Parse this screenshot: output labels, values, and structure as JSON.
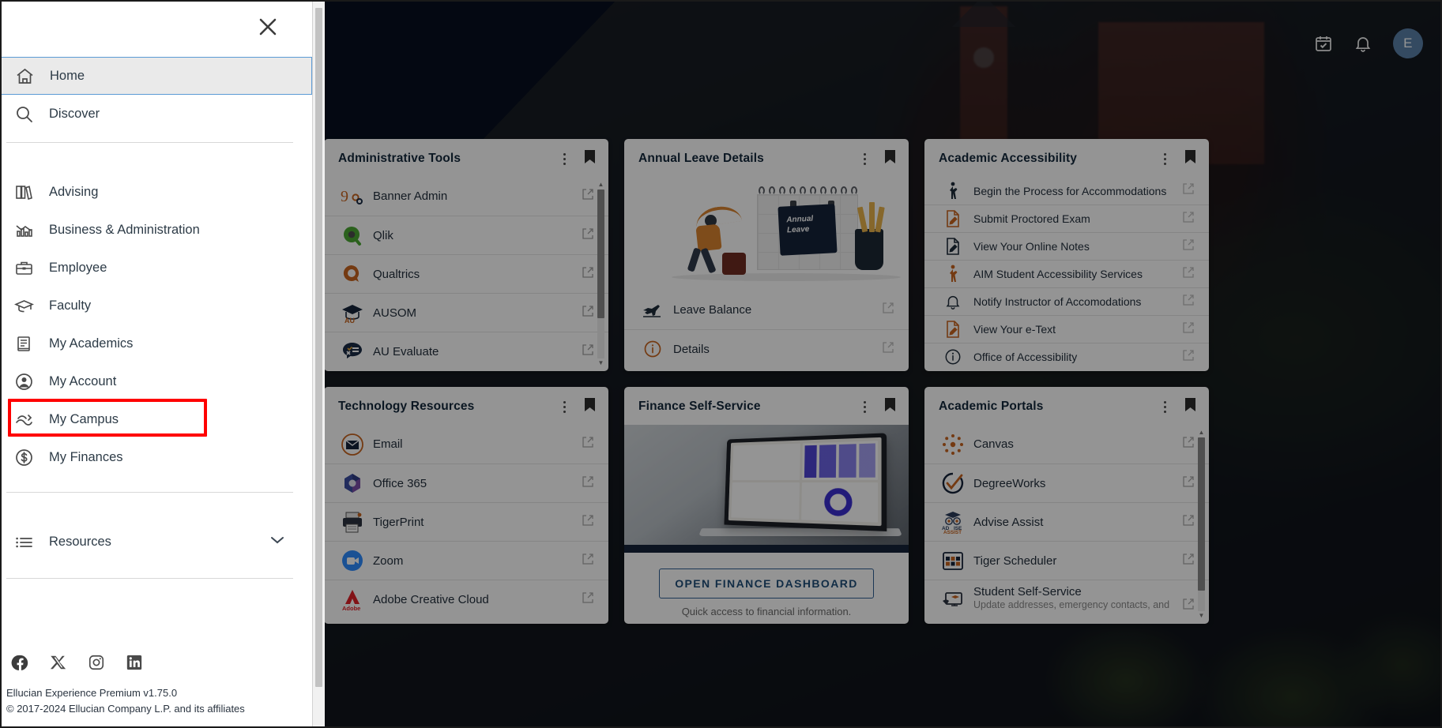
{
  "header": {
    "calendar_icon": "calendar-check-icon",
    "notifications_icon": "bell-icon",
    "avatar_initial": "E"
  },
  "sidebar": {
    "close_label": "close-icon",
    "primary_items": [
      {
        "label": "Home",
        "icon": "home-icon",
        "active": true
      },
      {
        "label": "Discover",
        "icon": "search-icon",
        "active": false
      }
    ],
    "section_items": [
      {
        "label": "Advising",
        "icon": "books-icon"
      },
      {
        "label": "Business & Administration",
        "icon": "chart-icon"
      },
      {
        "label": "Employee",
        "icon": "briefcase-icon"
      },
      {
        "label": "Faculty",
        "icon": "graduation-cap-icon"
      },
      {
        "label": "My Academics",
        "icon": "book-icon"
      },
      {
        "label": "My Account",
        "icon": "user-circle-icon"
      },
      {
        "label": "My Campus",
        "icon": "campus-icon",
        "highlighted": true
      },
      {
        "label": "My Finances",
        "icon": "dollar-circle-icon"
      }
    ],
    "resources": {
      "label": "Resources",
      "icon": "list-icon",
      "chevron": "chevron-down-icon"
    },
    "socials": [
      {
        "name": "facebook-icon"
      },
      {
        "name": "x-twitter-icon"
      },
      {
        "name": "instagram-icon"
      },
      {
        "name": "linkedin-icon"
      }
    ],
    "footer": {
      "version": "Ellucian Experience Premium v1.75.0",
      "copyright": "© 2017-2024 Ellucian Company L.P. and its affiliates"
    }
  },
  "cards": {
    "partial_left_row1": {
      "title": "",
      "kebab": "kebab-menu-icon",
      "bookmark": "bookmark-icon"
    },
    "partial_left_row2": {
      "title": "",
      "kebab": "kebab-menu-icon",
      "bookmark": "bookmark-icon"
    },
    "administrative_tools": {
      "title": "Administrative Tools",
      "items": [
        {
          "label": "Banner Admin",
          "icon": "banner9-icon"
        },
        {
          "label": "Qlik",
          "icon": "qlik-icon"
        },
        {
          "label": "Qualtrics",
          "icon": "qualtrics-icon"
        },
        {
          "label": "AUSOM",
          "icon": "ausom-icon"
        },
        {
          "label": "AU Evaluate",
          "icon": "au-evaluate-icon"
        }
      ]
    },
    "annual_leave": {
      "title": "Annual Leave Details",
      "illustration_text": "Annual\nLeave",
      "items": [
        {
          "label": "Leave Balance",
          "icon": "airplane-icon"
        },
        {
          "label": "Details",
          "icon": "info-circle-icon"
        }
      ]
    },
    "academic_accessibility": {
      "title": "Academic Accessibility",
      "items": [
        {
          "label": "Begin the Process for Accommodations",
          "icon": "walking-person-icon"
        },
        {
          "label": "Submit Proctored Exam",
          "icon": "document-edit-orange-icon"
        },
        {
          "label": "View Your Online Notes",
          "icon": "document-edit-navy-icon"
        },
        {
          "label": "AIM Student Accessibility Services",
          "icon": "walking-person-orange-icon"
        },
        {
          "label": "Notify Instructor of Accomodations",
          "icon": "bell-icon"
        },
        {
          "label": "View Your e-Text",
          "icon": "document-edit-orange-icon"
        },
        {
          "label": "Office of Accessibility",
          "icon": "info-circle-icon"
        }
      ]
    },
    "technology_resources": {
      "title": "Technology Resources",
      "items": [
        {
          "label": "Email",
          "icon": "envelope-icon"
        },
        {
          "label": "Office 365",
          "icon": "office365-icon"
        },
        {
          "label": "TigerPrint",
          "icon": "printer-icon"
        },
        {
          "label": "Zoom",
          "icon": "zoom-icon"
        },
        {
          "label": "Adobe Creative Cloud",
          "icon": "adobe-icon"
        }
      ]
    },
    "finance_self_service": {
      "title": "Finance Self-Service",
      "cta_label": "OPEN FINANCE DASHBOARD",
      "note": "Quick access to financial information."
    },
    "academic_portals": {
      "title": "Academic Portals",
      "items": [
        {
          "label": "Canvas",
          "icon": "canvas-icon",
          "sub": ""
        },
        {
          "label": "DegreeWorks",
          "icon": "degreeworks-icon",
          "sub": ""
        },
        {
          "label": "Advise Assist",
          "icon": "advise-assist-icon",
          "sub": ""
        },
        {
          "label": "Tiger Scheduler",
          "icon": "calendar-grid-icon",
          "sub": ""
        },
        {
          "label": "Student Self-Service",
          "icon": "student-self-service-icon",
          "sub": "Update addresses, emergency contacts, and"
        }
      ]
    }
  },
  "colors": {
    "accent_orange": "#d2691e",
    "navy": "#16243a",
    "highlight_red": "#ff0000",
    "focus_blue": "#5b9bd5",
    "avatar_blue": "#5a80a8"
  }
}
